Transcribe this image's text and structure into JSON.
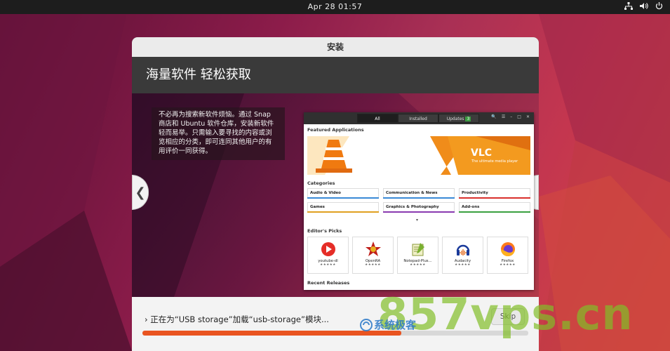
{
  "topbar": {
    "clock": "Apr 28  01:57",
    "tray_icons": [
      "network-icon",
      "volume-icon",
      "power-icon"
    ]
  },
  "window": {
    "title": "安装",
    "banner_title": "海量软件 轻松获取",
    "slide_description": "不必再为搜索新软件烦恼。通过 Snap 商店和 Ubuntu 软件仓库，安装新软件轻而易举。只需输入要寻找的内容或浏览相应的分类，即可连同其他用户的有用评价一同获得。",
    "prev_label": "❮",
    "next_label": "❯"
  },
  "store_preview": {
    "tabs": [
      "All",
      "Installed",
      "Updates"
    ],
    "updates_badge": "3",
    "featured_heading": "Featured Applications",
    "featured_app": "VLC",
    "featured_tagline": "The ultimate media player",
    "categories_heading": "Categories",
    "categories": [
      {
        "label": "Audio & Video",
        "color": "#3a8ad6"
      },
      {
        "label": "Communication & News",
        "color": "#3a8ad6"
      },
      {
        "label": "Productivity",
        "color": "#d9302c"
      },
      {
        "label": "Games",
        "color": "#e0a020"
      },
      {
        "label": "Graphics & Photography",
        "color": "#8a3ab0"
      },
      {
        "label": "Add-ons",
        "color": "#3aa040"
      }
    ],
    "more_indicator": "▾",
    "editors_heading": "Editor's Picks",
    "picks": [
      {
        "name": "youtube-dl",
        "rating": "★★★★★"
      },
      {
        "name": "OpenRA",
        "rating": "★★★★★"
      },
      {
        "name": "Notepad-Plus...",
        "rating": "★★★★★"
      },
      {
        "name": "Audacity",
        "rating": "★★★★★"
      },
      {
        "name": "Firefox",
        "rating": "★★★★★"
      }
    ],
    "recent_heading": "Recent Releases"
  },
  "install": {
    "status_text": "› 正在为“USB storage”加载“usb-storage”模块...",
    "skip_label": "Skip",
    "progress_fraction": 0.67,
    "accent_color": "#e95420"
  },
  "watermark": {
    "brand": "系统极客",
    "site": "857vps.cn"
  }
}
